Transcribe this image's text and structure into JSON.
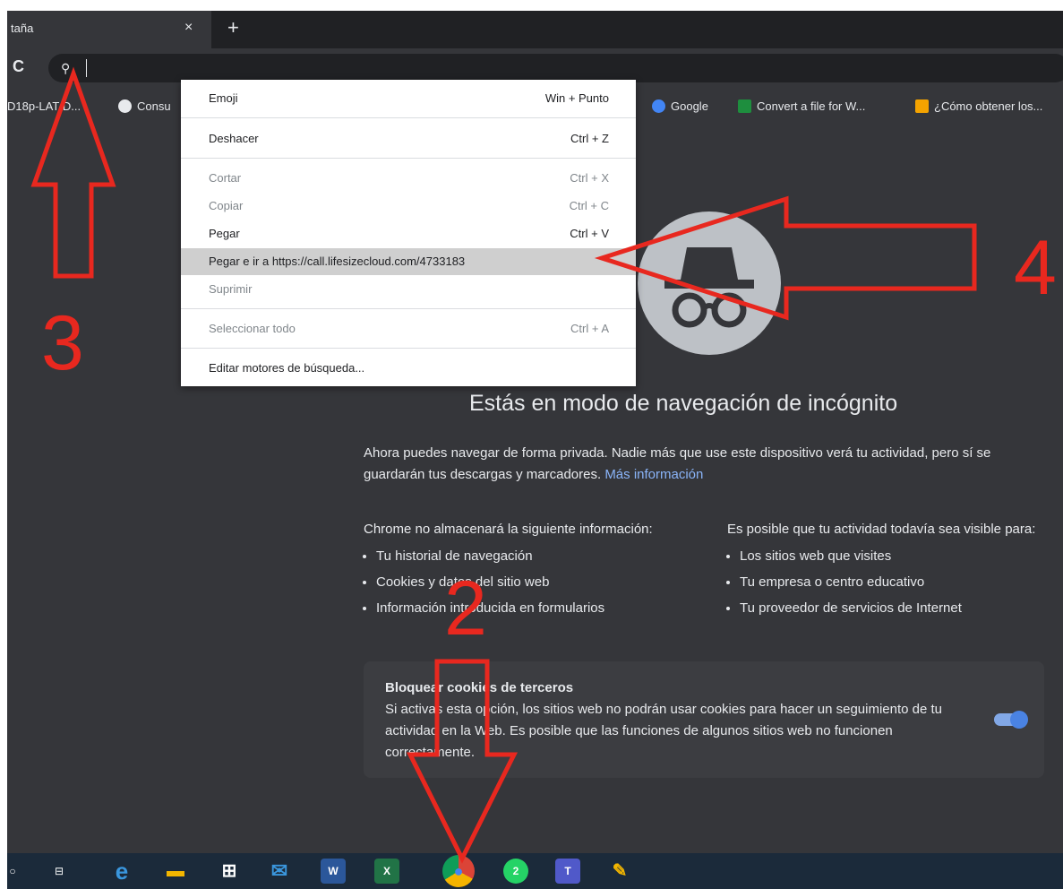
{
  "tab": {
    "title": "taña",
    "close": "×",
    "new_tab": "+"
  },
  "toolbar": {
    "reload": "C",
    "search_icon": "⚲"
  },
  "bookmarks": [
    {
      "label": "D18p-LAT-D..."
    },
    {
      "label": "Consu"
    },
    {
      "label": "Google"
    },
    {
      "label": "Convert a file for W..."
    },
    {
      "label": "¿Cómo obtener los..."
    }
  ],
  "context_menu": {
    "items": [
      {
        "label": "Emoji",
        "shortcut": "Win + Punto"
      },
      {
        "label": "Deshacer",
        "shortcut": "Ctrl + Z"
      },
      {
        "label": "Cortar",
        "shortcut": "Ctrl + X"
      },
      {
        "label": "Copiar",
        "shortcut": "Ctrl + C"
      },
      {
        "label": "Pegar",
        "shortcut": "Ctrl + V"
      },
      {
        "label": "Pegar e ir a https://call.lifesizecloud.com/4733183",
        "shortcut": ""
      },
      {
        "label": "Suprimir",
        "shortcut": ""
      },
      {
        "label": "Seleccionar todo",
        "shortcut": "Ctrl + A"
      },
      {
        "label": "Editar motores de búsqueda...",
        "shortcut": ""
      }
    ]
  },
  "incognito": {
    "title": "Estás en modo de navegación de incógnito",
    "intro": "Ahora puedes navegar de forma privada. Nadie más que use este dispositivo verá tu actividad, pero sí se guardarán tus descargas y marcadores.",
    "more_info": "Más información",
    "left_heading": "Chrome no almacenará la siguiente información:",
    "left_items": [
      "Tu historial de navegación",
      "Cookies y datos del sitio web",
      "Información introducida en formularios"
    ],
    "right_heading": "Es posible que tu actividad todavía sea visible para:",
    "right_items": [
      "Los sitios web que visites",
      "Tu empresa o centro educativo",
      "Tu proveedor de servicios de Internet"
    ],
    "cookie_title": "Bloquear cookies de terceros",
    "cookie_text": "Si activas esta opción, los sitios web no podrán usar cookies para hacer un seguimiento de tu actividad en la Web. Es posible que las funciones de algunos sitios web no funcionen correctamente.",
    "cookie_toggle_on": true
  },
  "annotations": {
    "n3": "3",
    "n4": "4",
    "n2": "2"
  },
  "taskbar": {
    "items": [
      {
        "name": "search",
        "glyph": "○"
      },
      {
        "name": "task-view",
        "glyph": "⊟"
      },
      {
        "name": "edge",
        "glyph": "e"
      },
      {
        "name": "file-explorer",
        "glyph": "▬"
      },
      {
        "name": "store",
        "glyph": "⊞"
      },
      {
        "name": "mail",
        "glyph": "✉"
      },
      {
        "name": "word",
        "glyph": "W"
      },
      {
        "name": "excel",
        "glyph": "X"
      },
      {
        "name": "chrome",
        "glyph": "●"
      },
      {
        "name": "whatsapp",
        "glyph": "2"
      },
      {
        "name": "teams",
        "glyph": "T"
      },
      {
        "name": "paint",
        "glyph": "✎"
      }
    ]
  },
  "colors": {
    "annotation_red": "#e8281f",
    "link_blue": "#8ab4f8",
    "toggle_blue": "#4c8bf5"
  }
}
